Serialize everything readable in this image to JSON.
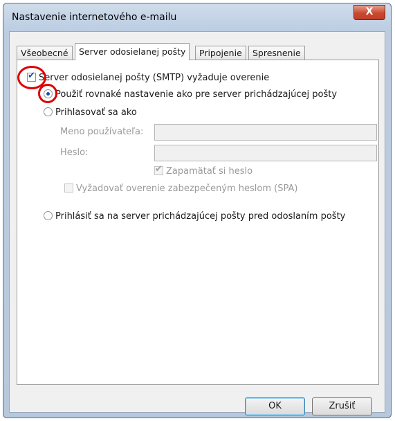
{
  "window": {
    "title": "Nastavenie internetového e-mailu",
    "close_label": "X"
  },
  "tabs": [
    {
      "label": "Všeobecné"
    },
    {
      "label": "Server odosielanej pošty"
    },
    {
      "label": "Pripojenie"
    },
    {
      "label": "Spresnenie"
    }
  ],
  "smtp": {
    "requires_auth_label": "Server odosielanej pošty (SMTP) vyžaduje overenie",
    "same_as_incoming_label": "Použiť rovnaké nastavenie ako pre server prichádzajúcej pošty",
    "login_as_label": "Prihlasovať sa ako",
    "username_label": "Meno používateľa:",
    "password_label": "Heslo:",
    "remember_password_label": "Zapamätať si heslo",
    "spa_label": "Vyžadovať overenie zabezpečeným heslom (SPA)",
    "login_before_send_label": "Prihlásiť sa na server prichádzajúcej pošty pred odoslaním pošty",
    "username_value": "",
    "password_value": ""
  },
  "buttons": {
    "ok": "OK",
    "cancel": "Zrušiť"
  },
  "colors": {
    "highlight": "#e00000",
    "accent": "#1e4fa3"
  }
}
